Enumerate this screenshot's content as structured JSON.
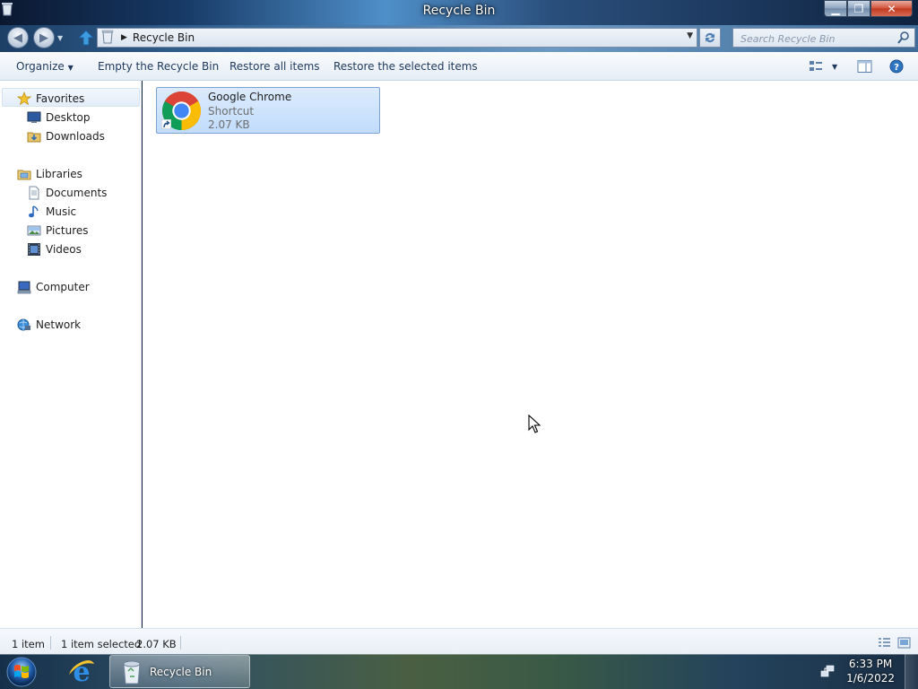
{
  "window": {
    "title": "Recycle Bin"
  },
  "address": {
    "crumb": "Recycle Bin",
    "search_placeholder": "Search Recycle Bin"
  },
  "toolbar": {
    "organize": "Organize",
    "empty": "Empty the Recycle Bin",
    "restore_all": "Restore all items",
    "restore_selected": "Restore the selected items"
  },
  "nav": {
    "favorites": {
      "label": "Favorites",
      "items": [
        "Desktop",
        "Downloads"
      ]
    },
    "libraries": {
      "label": "Libraries",
      "items": [
        "Documents",
        "Music",
        "Pictures",
        "Videos"
      ]
    },
    "computer": "Computer",
    "network": "Network"
  },
  "files": [
    {
      "name": "Google Chrome",
      "type": "Shortcut",
      "size": "2.07 KB",
      "selected": true
    }
  ],
  "status": {
    "count": "1 item",
    "selected": "1 item selected",
    "selected_size": "2.07 KB"
  },
  "taskbar": {
    "apps": [
      "Internet Explorer",
      "Recycle Bin"
    ],
    "active_label": "Recycle Bin",
    "time": "6:33 PM",
    "date": "1/6/2022"
  },
  "colors": {
    "selection": "#cde3fc",
    "accent": "#1e395b",
    "titlebar": "#173a66"
  },
  "icons": [
    "recycle-bin-icon",
    "back-icon",
    "forward-icon",
    "up-arrow-icon",
    "refresh-icon",
    "search-icon",
    "star-icon",
    "desktop-icon",
    "downloads-icon",
    "libraries-icon",
    "documents-icon",
    "music-icon",
    "pictures-icon",
    "videos-icon",
    "computer-icon",
    "network-icon",
    "chrome-icon",
    "shortcut-arrow-icon",
    "view-options-icon",
    "preview-pane-icon",
    "help-icon",
    "details-view-icon",
    "large-icons-view-icon",
    "start-orb-icon",
    "internet-explorer-icon",
    "network-tray-icon",
    "cursor-icon"
  ]
}
